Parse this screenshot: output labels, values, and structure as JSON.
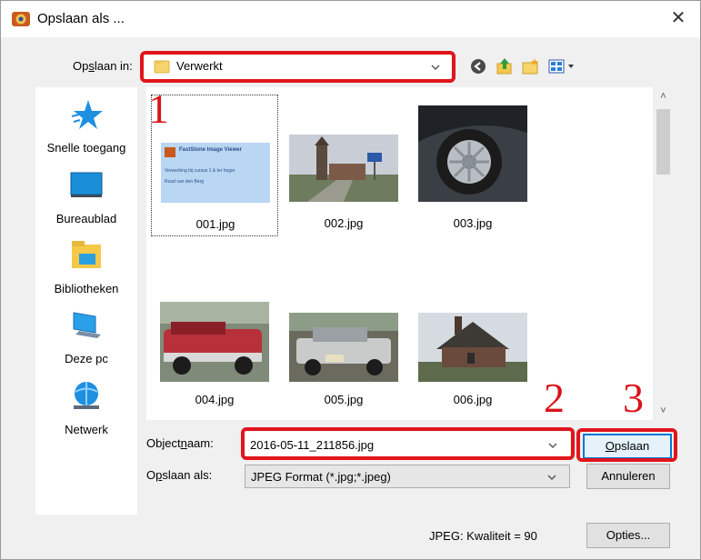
{
  "window": {
    "title": "Opslaan als ..."
  },
  "savein": {
    "label": "Opslaan in:",
    "label_pre": "Op",
    "label_u": "s",
    "label_post": "laan in:",
    "value": "Verwerkt"
  },
  "places": [
    {
      "label": "Snelle toegang",
      "icon": "star-icon"
    },
    {
      "label": "Bureaublad",
      "icon": "desktop-icon"
    },
    {
      "label": "Bibliotheken",
      "icon": "libraries-icon"
    },
    {
      "label": "Deze pc",
      "icon": "computer-icon"
    },
    {
      "label": "Netwerk",
      "icon": "network-icon"
    }
  ],
  "files": [
    {
      "name": "001.jpg",
      "selected": true
    },
    {
      "name": "002.jpg",
      "selected": false
    },
    {
      "name": "003.jpg",
      "selected": false
    },
    {
      "name": "004.jpg",
      "selected": false
    },
    {
      "name": "005.jpg",
      "selected": false
    },
    {
      "name": "006.jpg",
      "selected": false
    }
  ],
  "thumb001": {
    "line1": "FastStone Image Viewer",
    "line2": "Verwerking bij cursus 1 & ter hoger",
    "line3": "Ruud van den Berg"
  },
  "filename": {
    "label_pre": "Object",
    "label_u": "n",
    "label_post": "aam:",
    "value": "2016-05-11_211856.jpg"
  },
  "savetype": {
    "label_pre": "O",
    "label_u": "p",
    "label_post": "slaan als:",
    "value": "JPEG Format (*.jpg;*.jpeg)"
  },
  "buttons": {
    "save_u": "O",
    "save_rest": "pslaan",
    "cancel": "Annuleren",
    "options": "Opties..."
  },
  "quality": "JPEG: Kwaliteit = 90",
  "annotations": {
    "n1": "1",
    "n2": "2",
    "n3": "3"
  },
  "colors": {
    "annotation": "#e1141c",
    "folder": "#f6d46b",
    "accent": "#0078d7"
  }
}
